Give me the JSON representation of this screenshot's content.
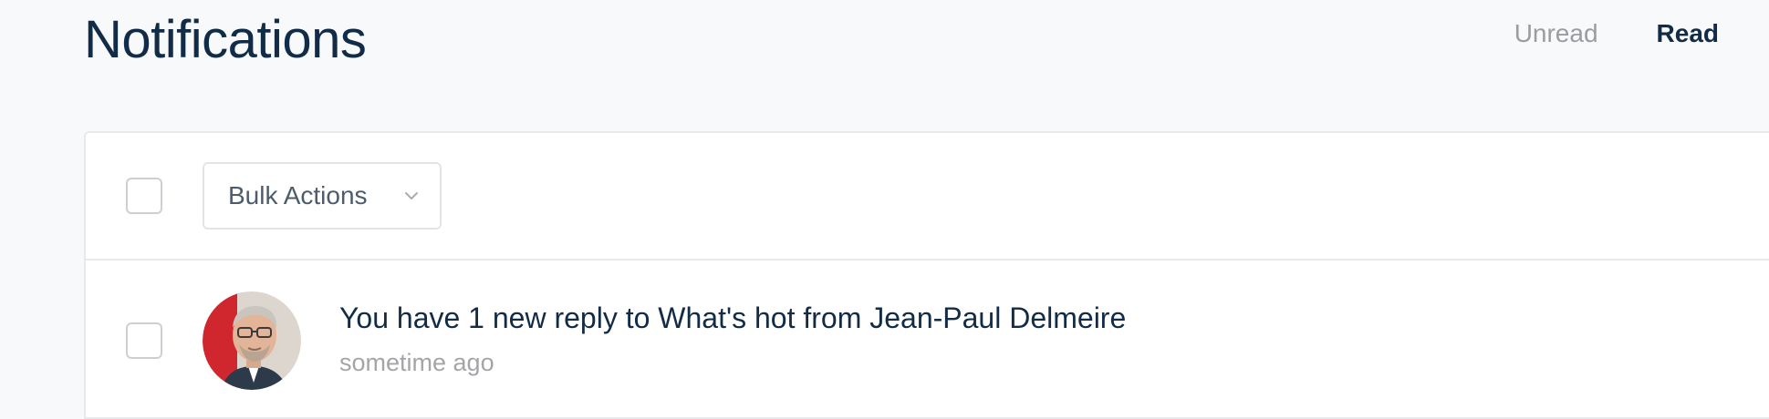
{
  "header": {
    "title": "Notifications",
    "filters": {
      "unread_label": "Unread",
      "read_label": "Read",
      "active": "Read"
    }
  },
  "toolbar": {
    "select_all_checked": false,
    "bulk_actions": {
      "selected_label": "Bulk Actions",
      "icon": "chevron-down-icon"
    }
  },
  "notifications": [
    {
      "checked": false,
      "avatar_alt": "user-avatar",
      "message": "You have 1 new reply to What's hot from Jean-Paul Delmeire",
      "time": "sometime ago"
    }
  ],
  "colors": {
    "page_background": "#f8f9fb",
    "title": "#122b46",
    "muted_text": "#9b9c9f",
    "border": "#e7e9ec",
    "avatar_accent": "#d0262d"
  }
}
